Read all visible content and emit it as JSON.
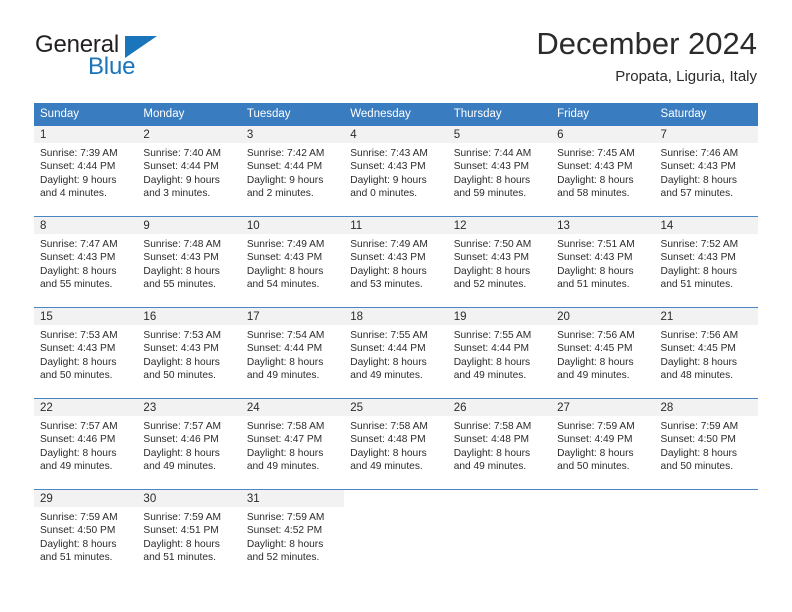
{
  "brand": {
    "word_one": "General",
    "word_two": "Blue",
    "accent_color": "#1b75bb",
    "triangle_icon": "triangle-icon"
  },
  "header": {
    "title": "December 2024",
    "subtitle": "Propata, Liguria, Italy"
  },
  "calendar": {
    "header_bg": "#3a7cc0",
    "daynumber_bg": "#f2f2f2",
    "weekdays": [
      "Sunday",
      "Monday",
      "Tuesday",
      "Wednesday",
      "Thursday",
      "Friday",
      "Saturday"
    ],
    "weeks": [
      [
        {
          "day": "1",
          "sunrise": "Sunrise: 7:39 AM",
          "sunset": "Sunset: 4:44 PM",
          "daylight_line1": "Daylight: 9 hours",
          "daylight_line2": "and 4 minutes."
        },
        {
          "day": "2",
          "sunrise": "Sunrise: 7:40 AM",
          "sunset": "Sunset: 4:44 PM",
          "daylight_line1": "Daylight: 9 hours",
          "daylight_line2": "and 3 minutes."
        },
        {
          "day": "3",
          "sunrise": "Sunrise: 7:42 AM",
          "sunset": "Sunset: 4:44 PM",
          "daylight_line1": "Daylight: 9 hours",
          "daylight_line2": "and 2 minutes."
        },
        {
          "day": "4",
          "sunrise": "Sunrise: 7:43 AM",
          "sunset": "Sunset: 4:43 PM",
          "daylight_line1": "Daylight: 9 hours",
          "daylight_line2": "and 0 minutes."
        },
        {
          "day": "5",
          "sunrise": "Sunrise: 7:44 AM",
          "sunset": "Sunset: 4:43 PM",
          "daylight_line1": "Daylight: 8 hours",
          "daylight_line2": "and 59 minutes."
        },
        {
          "day": "6",
          "sunrise": "Sunrise: 7:45 AM",
          "sunset": "Sunset: 4:43 PM",
          "daylight_line1": "Daylight: 8 hours",
          "daylight_line2": "and 58 minutes."
        },
        {
          "day": "7",
          "sunrise": "Sunrise: 7:46 AM",
          "sunset": "Sunset: 4:43 PM",
          "daylight_line1": "Daylight: 8 hours",
          "daylight_line2": "and 57 minutes."
        }
      ],
      [
        {
          "day": "8",
          "sunrise": "Sunrise: 7:47 AM",
          "sunset": "Sunset: 4:43 PM",
          "daylight_line1": "Daylight: 8 hours",
          "daylight_line2": "and 55 minutes."
        },
        {
          "day": "9",
          "sunrise": "Sunrise: 7:48 AM",
          "sunset": "Sunset: 4:43 PM",
          "daylight_line1": "Daylight: 8 hours",
          "daylight_line2": "and 55 minutes."
        },
        {
          "day": "10",
          "sunrise": "Sunrise: 7:49 AM",
          "sunset": "Sunset: 4:43 PM",
          "daylight_line1": "Daylight: 8 hours",
          "daylight_line2": "and 54 minutes."
        },
        {
          "day": "11",
          "sunrise": "Sunrise: 7:49 AM",
          "sunset": "Sunset: 4:43 PM",
          "daylight_line1": "Daylight: 8 hours",
          "daylight_line2": "and 53 minutes."
        },
        {
          "day": "12",
          "sunrise": "Sunrise: 7:50 AM",
          "sunset": "Sunset: 4:43 PM",
          "daylight_line1": "Daylight: 8 hours",
          "daylight_line2": "and 52 minutes."
        },
        {
          "day": "13",
          "sunrise": "Sunrise: 7:51 AM",
          "sunset": "Sunset: 4:43 PM",
          "daylight_line1": "Daylight: 8 hours",
          "daylight_line2": "and 51 minutes."
        },
        {
          "day": "14",
          "sunrise": "Sunrise: 7:52 AM",
          "sunset": "Sunset: 4:43 PM",
          "daylight_line1": "Daylight: 8 hours",
          "daylight_line2": "and 51 minutes."
        }
      ],
      [
        {
          "day": "15",
          "sunrise": "Sunrise: 7:53 AM",
          "sunset": "Sunset: 4:43 PM",
          "daylight_line1": "Daylight: 8 hours",
          "daylight_line2": "and 50 minutes."
        },
        {
          "day": "16",
          "sunrise": "Sunrise: 7:53 AM",
          "sunset": "Sunset: 4:43 PM",
          "daylight_line1": "Daylight: 8 hours",
          "daylight_line2": "and 50 minutes."
        },
        {
          "day": "17",
          "sunrise": "Sunrise: 7:54 AM",
          "sunset": "Sunset: 4:44 PM",
          "daylight_line1": "Daylight: 8 hours",
          "daylight_line2": "and 49 minutes."
        },
        {
          "day": "18",
          "sunrise": "Sunrise: 7:55 AM",
          "sunset": "Sunset: 4:44 PM",
          "daylight_line1": "Daylight: 8 hours",
          "daylight_line2": "and 49 minutes."
        },
        {
          "day": "19",
          "sunrise": "Sunrise: 7:55 AM",
          "sunset": "Sunset: 4:44 PM",
          "daylight_line1": "Daylight: 8 hours",
          "daylight_line2": "and 49 minutes."
        },
        {
          "day": "20",
          "sunrise": "Sunrise: 7:56 AM",
          "sunset": "Sunset: 4:45 PM",
          "daylight_line1": "Daylight: 8 hours",
          "daylight_line2": "and 49 minutes."
        },
        {
          "day": "21",
          "sunrise": "Sunrise: 7:56 AM",
          "sunset": "Sunset: 4:45 PM",
          "daylight_line1": "Daylight: 8 hours",
          "daylight_line2": "and 48 minutes."
        }
      ],
      [
        {
          "day": "22",
          "sunrise": "Sunrise: 7:57 AM",
          "sunset": "Sunset: 4:46 PM",
          "daylight_line1": "Daylight: 8 hours",
          "daylight_line2": "and 49 minutes."
        },
        {
          "day": "23",
          "sunrise": "Sunrise: 7:57 AM",
          "sunset": "Sunset: 4:46 PM",
          "daylight_line1": "Daylight: 8 hours",
          "daylight_line2": "and 49 minutes."
        },
        {
          "day": "24",
          "sunrise": "Sunrise: 7:58 AM",
          "sunset": "Sunset: 4:47 PM",
          "daylight_line1": "Daylight: 8 hours",
          "daylight_line2": "and 49 minutes."
        },
        {
          "day": "25",
          "sunrise": "Sunrise: 7:58 AM",
          "sunset": "Sunset: 4:48 PM",
          "daylight_line1": "Daylight: 8 hours",
          "daylight_line2": "and 49 minutes."
        },
        {
          "day": "26",
          "sunrise": "Sunrise: 7:58 AM",
          "sunset": "Sunset: 4:48 PM",
          "daylight_line1": "Daylight: 8 hours",
          "daylight_line2": "and 49 minutes."
        },
        {
          "day": "27",
          "sunrise": "Sunrise: 7:59 AM",
          "sunset": "Sunset: 4:49 PM",
          "daylight_line1": "Daylight: 8 hours",
          "daylight_line2": "and 50 minutes."
        },
        {
          "day": "28",
          "sunrise": "Sunrise: 7:59 AM",
          "sunset": "Sunset: 4:50 PM",
          "daylight_line1": "Daylight: 8 hours",
          "daylight_line2": "and 50 minutes."
        }
      ],
      [
        {
          "day": "29",
          "sunrise": "Sunrise: 7:59 AM",
          "sunset": "Sunset: 4:50 PM",
          "daylight_line1": "Daylight: 8 hours",
          "daylight_line2": "and 51 minutes."
        },
        {
          "day": "30",
          "sunrise": "Sunrise: 7:59 AM",
          "sunset": "Sunset: 4:51 PM",
          "daylight_line1": "Daylight: 8 hours",
          "daylight_line2": "and 51 minutes."
        },
        {
          "day": "31",
          "sunrise": "Sunrise: 7:59 AM",
          "sunset": "Sunset: 4:52 PM",
          "daylight_line1": "Daylight: 8 hours",
          "daylight_line2": "and 52 minutes."
        },
        {
          "day": "",
          "sunrise": "",
          "sunset": "",
          "daylight_line1": "",
          "daylight_line2": ""
        },
        {
          "day": "",
          "sunrise": "",
          "sunset": "",
          "daylight_line1": "",
          "daylight_line2": ""
        },
        {
          "day": "",
          "sunrise": "",
          "sunset": "",
          "daylight_line1": "",
          "daylight_line2": ""
        },
        {
          "day": "",
          "sunrise": "",
          "sunset": "",
          "daylight_line1": "",
          "daylight_line2": ""
        }
      ]
    ]
  }
}
